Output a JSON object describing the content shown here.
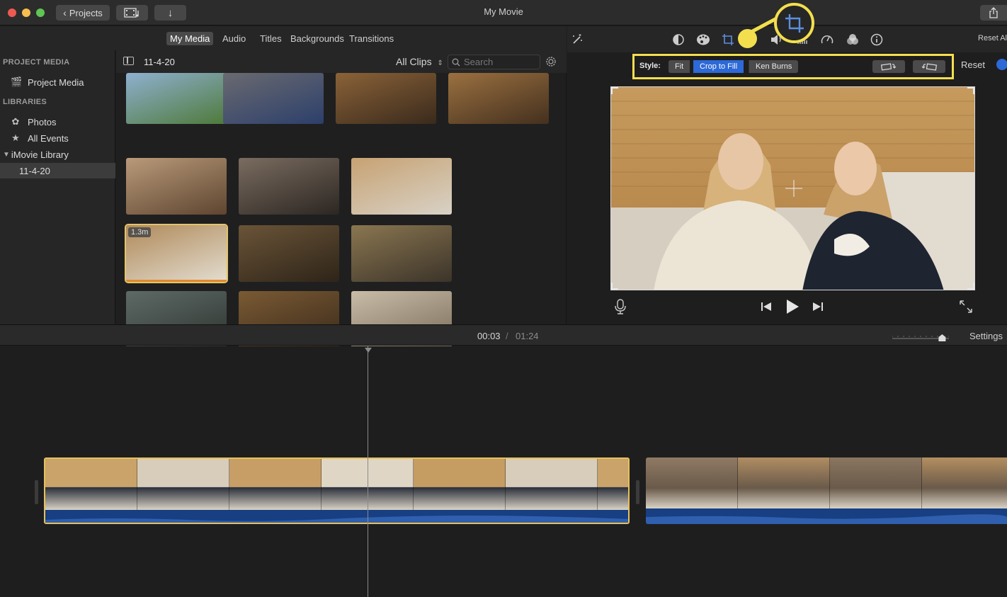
{
  "window": {
    "title": "My Movie"
  },
  "toolbar": {
    "projects_label": "Projects"
  },
  "browser_tabs": [
    {
      "label": "My Media",
      "active": true
    },
    {
      "label": "Audio"
    },
    {
      "label": "Titles"
    },
    {
      "label": "Backgrounds"
    },
    {
      "label": "Transitions"
    }
  ],
  "sidebar": {
    "project_media_header": "PROJECT MEDIA",
    "project_media_item": "Project Media",
    "libraries_header": "LIBRARIES",
    "photos": "Photos",
    "all_events": "All Events",
    "library": "iMovie Library",
    "event": "11-4-20"
  },
  "browser": {
    "event_label": "11-4-20",
    "clips_filter": "All Clips",
    "search_placeholder": "Search",
    "clip_duration_badge": "1.3m"
  },
  "thumbnails": [
    {
      "scene": "lmu-sign",
      "colors": [
        "#8fb0d0",
        "#4e7a3a"
      ]
    },
    {
      "scene": "pennant-wall",
      "colors": [
        "#6a6a70",
        "#2c3f6b"
      ]
    },
    {
      "scene": "shelf-decor-1",
      "colors": [
        "#8a6238",
        "#3a2a1c"
      ]
    },
    {
      "scene": "shelf-decor-2",
      "colors": [
        "#9a7040",
        "#44301e"
      ]
    },
    {
      "scene": "heart-wall",
      "colors": [
        "#b99a7a",
        "#5e4530"
      ]
    },
    {
      "scene": "drawer",
      "colors": [
        "#7a6c60",
        "#2c2622"
      ]
    },
    {
      "scene": "two-girls-bed",
      "colors": [
        "#c7a273",
        "#d8d2c6"
      ]
    },
    {
      "scene": "girls-folding",
      "colors": [
        "#b08a5a",
        "#e3ddd0"
      ]
    },
    {
      "scene": "closet",
      "colors": [
        "#6a5438",
        "#2e2418"
      ]
    },
    {
      "scene": "desk-hand",
      "colors": [
        "#8a7650",
        "#3c342a"
      ]
    },
    {
      "scene": "blurry-floor",
      "colors": [
        "#5e6a66",
        "#2e3430"
      ]
    },
    {
      "scene": "doorway",
      "colors": [
        "#7a5a34",
        "#3a2a1a"
      ]
    },
    {
      "scene": "bedding",
      "colors": [
        "#c9bda8",
        "#7a6c5a"
      ]
    }
  ],
  "adjust_bar": {
    "reset_all": "Reset Al"
  },
  "crop": {
    "style_label": "Style:",
    "fit": "Fit",
    "crop_to_fill": "Crop to Fill",
    "ken_burns": "Ken Burns",
    "reset": "Reset",
    "selected_style": "Crop to Fill"
  },
  "timeline": {
    "current_time": "00:03",
    "separator": "/",
    "total_time": "01:24",
    "settings": "Settings",
    "zoom_level": 0.88
  },
  "colors": {
    "highlight": "#f3df4e",
    "accent_blue": "#2d69d7",
    "clip_border": "#e6c15a",
    "audio_wave": "#2f5fae"
  },
  "icons": {
    "magic": "magic-wand-icon",
    "color_balance": "color-balance-icon",
    "color_correction": "color-palette-icon",
    "crop": "crop-icon",
    "stabilization": "camera-icon",
    "volume": "speaker-icon",
    "noise": "equalizer-icon",
    "speed": "speedometer-icon",
    "filter": "clip-filter-icon",
    "info": "info-icon"
  }
}
